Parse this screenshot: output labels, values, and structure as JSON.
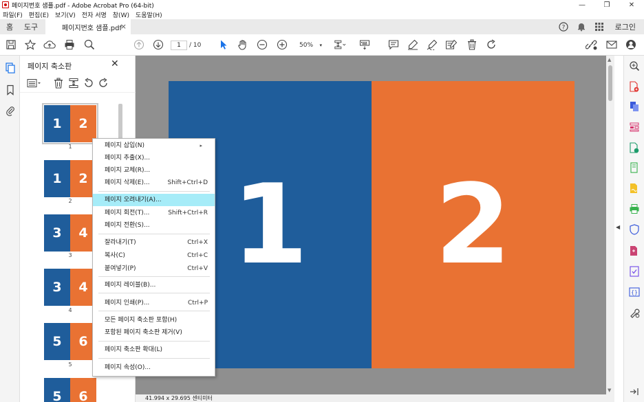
{
  "window": {
    "title": "페이지번호 샘플.pdf - Adobe Acrobat Pro (64-bit)",
    "minimize": "—",
    "restore": "❐",
    "close": "✕"
  },
  "menubar": [
    "파일(F)",
    "편집(E)",
    "보기(V)",
    "전자 서명",
    "창(W)",
    "도움말(H)"
  ],
  "tabs": {
    "home": "홈",
    "tools": "도구",
    "document": "페이지번호 샘플.pdf",
    "close": "×",
    "login": "로그인"
  },
  "toolbar": {
    "current_page": "1",
    "total_pages": "/ 10",
    "zoom": "50%",
    "zoom_caret": "▾"
  },
  "thumbnails_panel": {
    "title": "페이지 축소판",
    "close": "✕",
    "thumbnails": [
      {
        "left": "1",
        "right": "2",
        "page": "1",
        "selected": true
      },
      {
        "left": "1",
        "right": "2",
        "page": "2",
        "selected": false
      },
      {
        "left": "3",
        "right": "4",
        "page": "3",
        "selected": false
      },
      {
        "left": "3",
        "right": "4",
        "page": "4",
        "selected": false
      },
      {
        "left": "5",
        "right": "6",
        "page": "5",
        "selected": false
      },
      {
        "left": "5",
        "right": "6",
        "page": "",
        "selected": false
      }
    ]
  },
  "document": {
    "left_number": "1",
    "right_number": "2",
    "blue": "#1f5d9b",
    "orange": "#e97233"
  },
  "status_bar": {
    "size": "41.994 x 29.695 센티미터"
  },
  "context_menu": {
    "items": [
      {
        "label": "페이지 삽입(N)",
        "shortcut": "",
        "submenu": "▸"
      },
      {
        "label": "페이지 추출(X)...",
        "shortcut": ""
      },
      {
        "label": "페이지 교체(R)...",
        "shortcut": ""
      },
      {
        "label": "페이지 삭제(E)...",
        "shortcut": "Shift+Ctrl+D"
      },
      {
        "label": "페이지 오려내기(A)...",
        "shortcut": "",
        "highlighted": true
      },
      {
        "label": "페이지 회전(T)...",
        "shortcut": "Shift+Ctrl+R"
      },
      {
        "label": "페이지 전환(S)...",
        "shortcut": ""
      },
      {
        "label": "잘라내기(T)",
        "shortcut": "Ctrl+X"
      },
      {
        "label": "복사(C)",
        "shortcut": "Ctrl+C"
      },
      {
        "label": "붙여넣기(P)",
        "shortcut": "Ctrl+V"
      },
      {
        "label": "페이지 레이블(B)...",
        "shortcut": ""
      },
      {
        "label": "페이지 인쇄(P)...",
        "shortcut": "Ctrl+P"
      },
      {
        "label": "모든 페이지 축소판 포함(H)",
        "shortcut": ""
      },
      {
        "label": "포함된 페이지 축소판 제거(V)",
        "shortcut": ""
      },
      {
        "label": "페이지 축소판 확대(L)",
        "shortcut": ""
      },
      {
        "label": "페이지 속성(O)...",
        "shortcut": ""
      }
    ],
    "highlight_color": "#a6ecf8"
  },
  "scroll": {
    "up": "▲",
    "down": "▼",
    "collapse": "◀"
  }
}
